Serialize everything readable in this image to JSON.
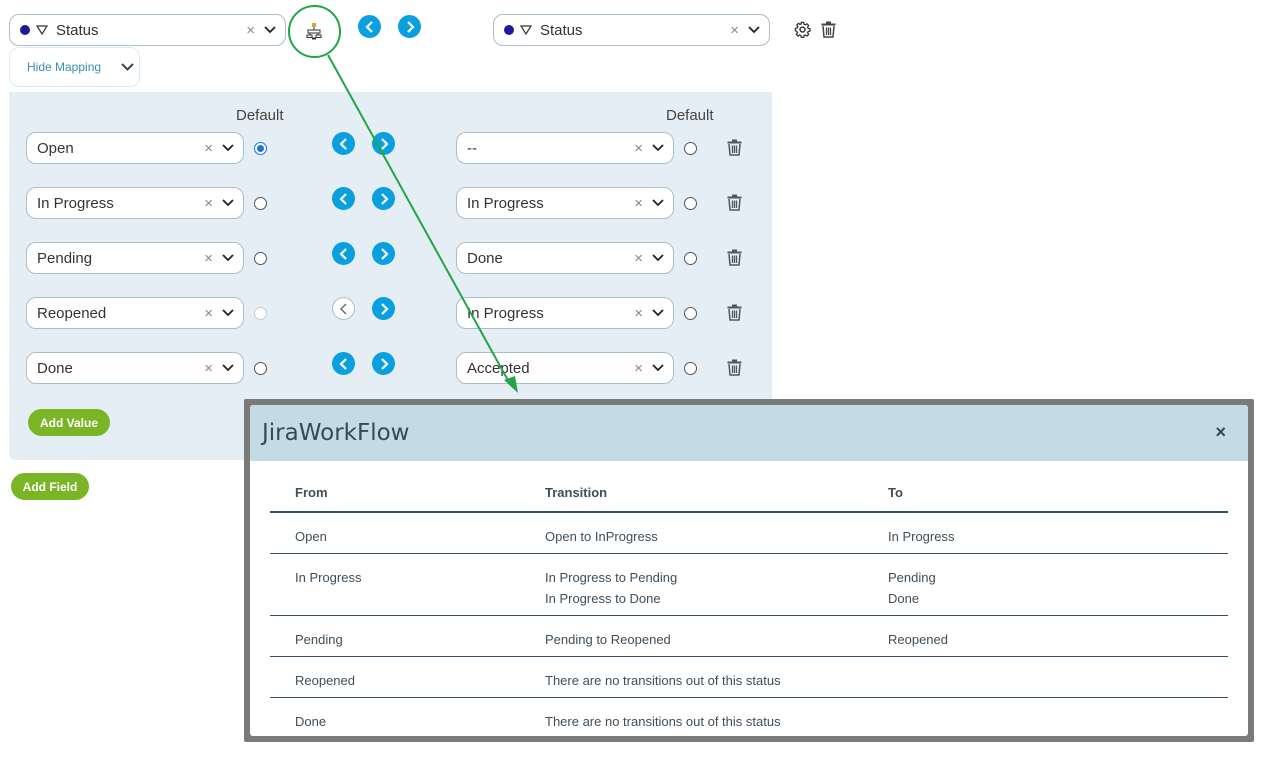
{
  "top": {
    "source_field": {
      "value": "Status",
      "dot_color": "#1d1a9e"
    },
    "target_field": {
      "value": "Status",
      "dot_color": "#1d1a9e"
    },
    "hide_mapping_label": "Hide Mapping",
    "icons": {
      "workflow": "workflow-diagram-icon",
      "prev": "chevron-left-icon",
      "next": "chevron-right-icon",
      "settings": "gear-icon",
      "delete": "trash-icon"
    }
  },
  "mapping": {
    "default_label_left": "Default",
    "default_label_right": "Default",
    "rows": [
      {
        "source": "Open",
        "source_default": true,
        "source_disabled": false,
        "target": "--",
        "prev_disabled": false
      },
      {
        "source": "In Progress",
        "source_default": false,
        "source_disabled": false,
        "target": "In Progress",
        "prev_disabled": false
      },
      {
        "source": "Pending",
        "source_default": false,
        "source_disabled": false,
        "target": "Done",
        "prev_disabled": false
      },
      {
        "source": "Reopened",
        "source_default": false,
        "source_disabled": true,
        "target": "In Progress",
        "prev_disabled": true
      },
      {
        "source": "Done",
        "source_default": false,
        "source_disabled": false,
        "target": "Accepted",
        "prev_disabled": false
      }
    ],
    "add_value_label": "Add Value"
  },
  "add_field_label": "Add Field",
  "background_ghost": {
    "target_value": "Done"
  },
  "colors": {
    "accent_blue": "#0aa0e0",
    "green_button": "#7ab526",
    "annotation_green": "#22a546",
    "panel_bg": "#e5eef4",
    "modal_header_bg": "#c4dbe4"
  },
  "modal": {
    "title": "JiraWorkFlow",
    "close_label": "×",
    "columns": [
      "From",
      "Transition",
      "To"
    ],
    "rows": [
      {
        "from": "Open",
        "transitions": [
          "Open to InProgress"
        ],
        "to": [
          "In Progress"
        ]
      },
      {
        "from": "In Progress",
        "transitions": [
          "In Progress to Pending",
          "In Progress to Done"
        ],
        "to": [
          "Pending",
          "Done"
        ]
      },
      {
        "from": "Pending",
        "transitions": [
          "Pending to Reopened"
        ],
        "to": [
          "Reopened"
        ]
      },
      {
        "from": "Reopened",
        "transitions": [
          "There are no transitions out of this status"
        ],
        "to": []
      },
      {
        "from": "Done",
        "transitions": [
          "There are no transitions out of this status"
        ],
        "to": []
      }
    ]
  }
}
